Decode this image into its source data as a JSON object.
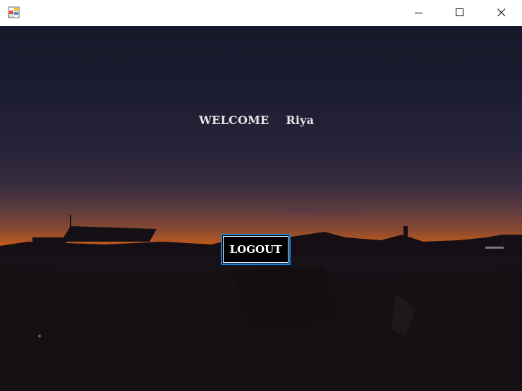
{
  "window": {
    "app_icon": "windows-form-icon",
    "controls": {
      "minimize_icon": "minimize-icon",
      "maximize_icon": "maximize-icon",
      "close_icon": "close-icon"
    }
  },
  "main": {
    "welcome_label": "WELCOME",
    "user_name": "Riya",
    "logout_label": "LOGOUT",
    "background": "sunset-city-silhouette"
  },
  "colors": {
    "button_border": "#1e7fd8",
    "button_bg": "#000000",
    "text": "#e8e2e6"
  }
}
